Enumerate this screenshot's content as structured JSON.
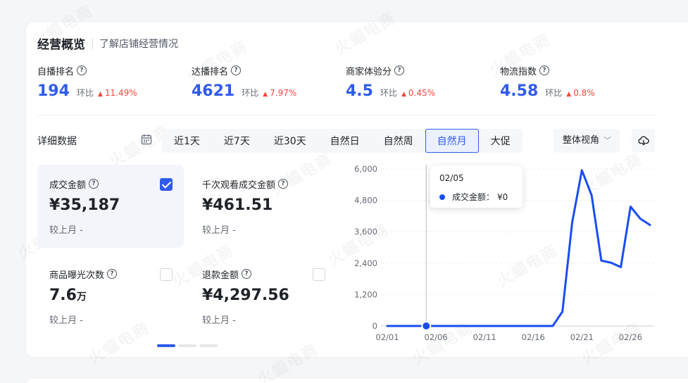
{
  "overview": {
    "title": "经营概览",
    "subtitle": "了解店铺经营情况"
  },
  "metrics": [
    {
      "label": "自播排名",
      "value": "194",
      "compare_label": "环比",
      "change": "11.49%"
    },
    {
      "label": "达播排名",
      "value": "4621",
      "compare_label": "环比",
      "change": "7.97%"
    },
    {
      "label": "商家体验分",
      "value": "4.5",
      "compare_label": "环比",
      "change": "0.45%"
    },
    {
      "label": "物流指数",
      "value": "4.58",
      "compare_label": "环比",
      "change": "0.8%"
    }
  ],
  "detail": {
    "label": "详细数据",
    "tabs": [
      "近1天",
      "近7天",
      "近30天",
      "自然日",
      "自然周",
      "自然月",
      "大促"
    ],
    "active_tab": "自然月",
    "view_select": "整体视角"
  },
  "kpi_cards": [
    {
      "label": "成交金额",
      "value": "¥35,187",
      "compare": "较上月 -",
      "checked": true
    },
    {
      "label": "千次观看成交金额",
      "value": "¥461.51",
      "compare": "较上月 -",
      "checked": false
    },
    {
      "label": "商品曝光次数",
      "value": "7.6",
      "unit": "万",
      "compare": "较上月 -",
      "checked": false
    },
    {
      "label": "退款金额",
      "value": "¥4,297.56",
      "compare": "较上月 -",
      "checked": false
    }
  ],
  "tooltip": {
    "date": "02/05",
    "series": "成交金额：",
    "value": "¥0"
  },
  "watermark": "火蝠电商",
  "colors": {
    "accent": "#2f5bea",
    "line": "#1a4df0",
    "up": "#f5453d"
  },
  "chart_data": {
    "type": "line",
    "x": [
      "02/01",
      "02/02",
      "02/03",
      "02/04",
      "02/05",
      "02/06",
      "02/07",
      "02/08",
      "02/09",
      "02/10",
      "02/11",
      "02/12",
      "02/13",
      "02/14",
      "02/15",
      "02/16",
      "02/17",
      "02/18",
      "02/19",
      "02/20",
      "02/21",
      "02/22",
      "02/23",
      "02/24",
      "02/25",
      "02/26",
      "02/27",
      "02/28"
    ],
    "xticks": [
      "02/01",
      "02/06",
      "02/11",
      "02/16",
      "02/21",
      "02/26"
    ],
    "series": [
      {
        "name": "成交金额",
        "values": [
          0,
          0,
          0,
          0,
          0,
          0,
          0,
          0,
          0,
          0,
          0,
          0,
          0,
          0,
          0,
          0,
          0,
          0,
          550,
          3950,
          5950,
          5000,
          2500,
          2420,
          2250,
          4560,
          4100,
          3860
        ]
      }
    ],
    "yticks": [
      "0",
      "1,200",
      "2,400",
      "3,600",
      "4,800",
      "6,000"
    ],
    "ylim": [
      0,
      6000
    ],
    "highlight_index": 4,
    "grid": true
  }
}
